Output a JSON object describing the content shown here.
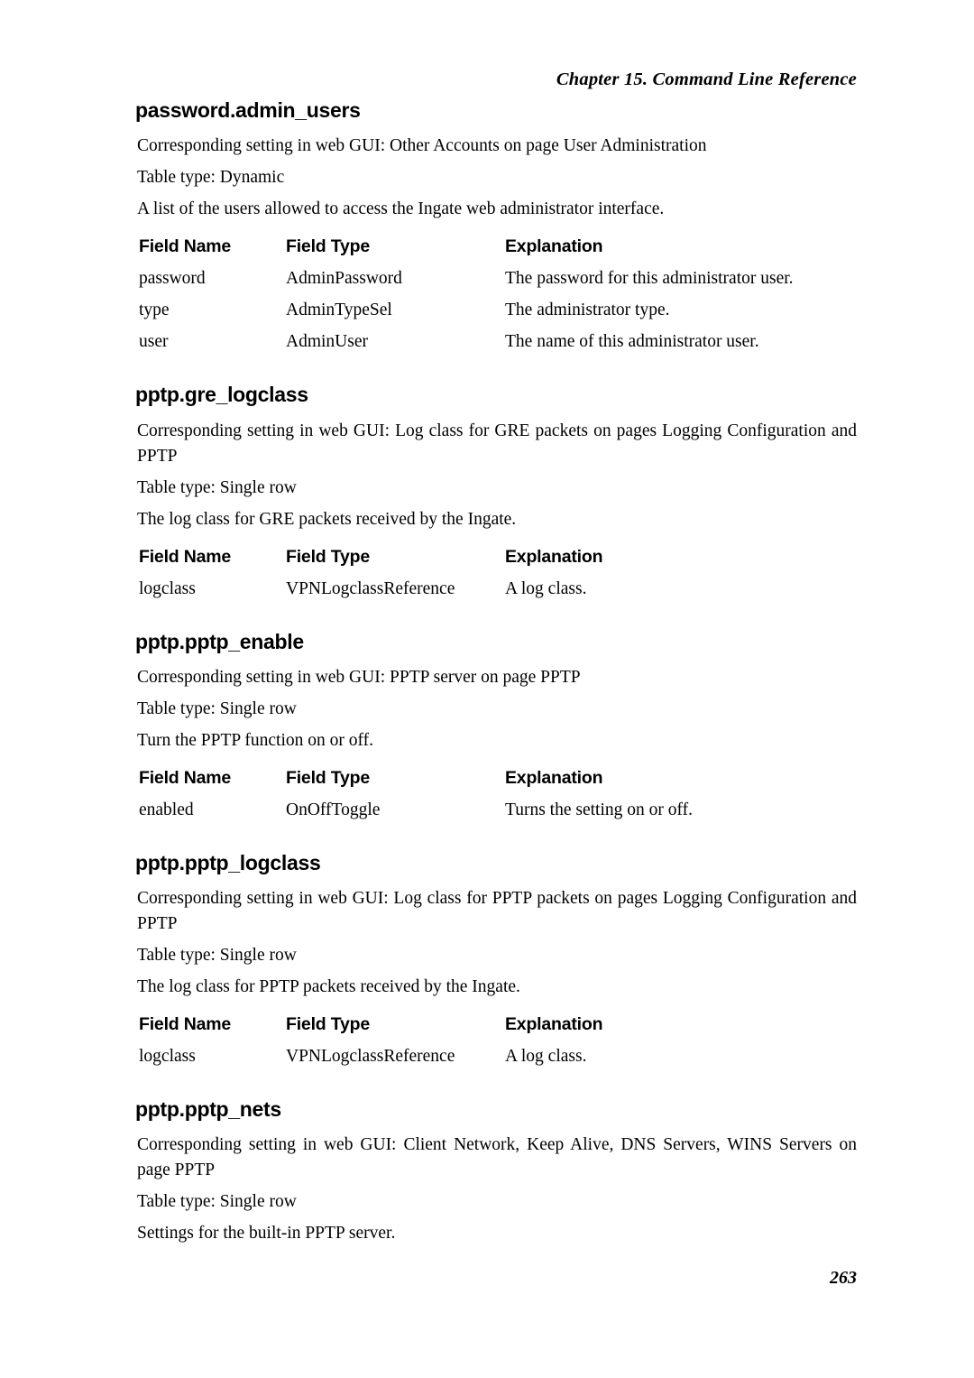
{
  "header": {
    "running_head": "Chapter 15. Command Line Reference"
  },
  "footer": {
    "page_number": "263"
  },
  "table_headers": {
    "field_name": "Field Name",
    "field_type": "Field Type",
    "explanation": "Explanation"
  },
  "sections": [
    {
      "title": "password.admin_users",
      "paragraphs": [
        "Corresponding setting in web GUI: Other Accounts on page User Administration",
        "Table type: Dynamic",
        "A list of the users allowed to access the Ingate web administrator interface."
      ],
      "rows": [
        {
          "field_name": "password",
          "field_type": "AdminPassword",
          "explanation": "The password for this administrator user."
        },
        {
          "field_name": "type",
          "field_type": "AdminTypeSel",
          "explanation": "The administrator type."
        },
        {
          "field_name": "user",
          "field_type": "AdminUser",
          "explanation": "The name of this administrator user."
        }
      ]
    },
    {
      "title": "pptp.gre_logclass",
      "paragraphs": [
        "Corresponding setting in web GUI: Log class for GRE packets on pages Logging Configuration and PPTP",
        "Table type: Single row",
        "The log class for GRE packets received by the Ingate."
      ],
      "rows": [
        {
          "field_name": "logclass",
          "field_type": "VPNLogclassReference",
          "explanation": "A log class."
        }
      ]
    },
    {
      "title": "pptp.pptp_enable",
      "paragraphs": [
        "Corresponding setting in web GUI: PPTP server on page PPTP",
        "Table type: Single row",
        "Turn the PPTP function on or off."
      ],
      "rows": [
        {
          "field_name": "enabled",
          "field_type": "OnOffToggle",
          "explanation": "Turns the setting on or off."
        }
      ]
    },
    {
      "title": "pptp.pptp_logclass",
      "paragraphs": [
        "Corresponding setting in web GUI: Log class for PPTP packets on pages Logging Configuration and PPTP",
        "Table type: Single row",
        "The log class for PPTP packets received by the Ingate."
      ],
      "rows": [
        {
          "field_name": "logclass",
          "field_type": "VPNLogclassReference",
          "explanation": "A log class."
        }
      ]
    },
    {
      "title": "pptp.pptp_nets",
      "paragraphs": [
        "Corresponding setting in web GUI: Client Network, Keep Alive, DNS Servers, WINS Servers on page PPTP",
        "Table type: Single row",
        "Settings for the built-in PPTP server."
      ],
      "rows": []
    }
  ]
}
